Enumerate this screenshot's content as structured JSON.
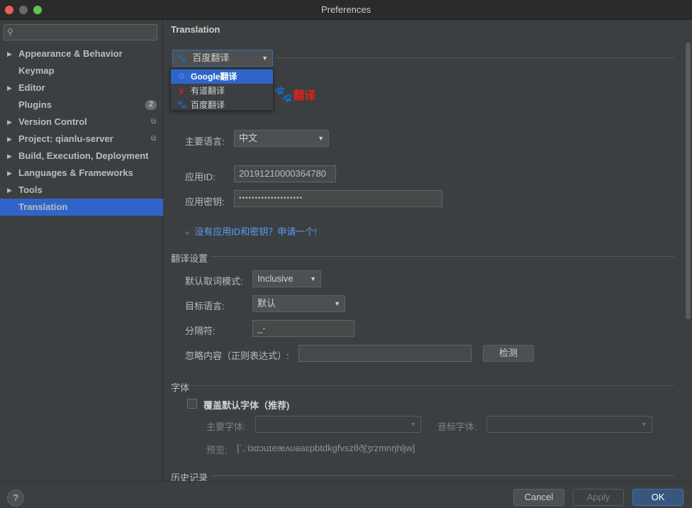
{
  "window": {
    "title": "Preferences"
  },
  "sidebar": {
    "search_placeholder": "",
    "items": [
      {
        "label": "Appearance & Behavior",
        "expandable": true
      },
      {
        "label": "Keymap",
        "expandable": false
      },
      {
        "label": "Editor",
        "expandable": true
      },
      {
        "label": "Plugins",
        "expandable": false,
        "badge": "2"
      },
      {
        "label": "Version Control",
        "expandable": true
      },
      {
        "label": "Project: qianlu-server",
        "expandable": true
      },
      {
        "label": "Build, Execution, Deployment",
        "expandable": true
      },
      {
        "label": "Languages & Frameworks",
        "expandable": true
      },
      {
        "label": "Tools",
        "expandable": true
      },
      {
        "label": "Translation",
        "expandable": false,
        "selected": true
      }
    ]
  },
  "main": {
    "title": "Translation",
    "engine": {
      "selected": "百度翻译",
      "options": [
        "Google翻译",
        "有道翻译",
        "百度翻译"
      ],
      "highlighted": "Google翻译",
      "logo_text": "翻译"
    },
    "primary_language_label": "主要语言:",
    "primary_language_value": "中文",
    "app_id_label": "应用ID:",
    "app_id_value": "20191210000364780",
    "app_key_label": "应用密钥:",
    "app_key_value": "••••••••••••••••••••",
    "apply_link": "没有应用ID和密钥？申请一个!",
    "translate_settings": {
      "title": "翻译设置",
      "word_mode_label": "默认取词模式:",
      "word_mode_value": "Inclusive",
      "target_lang_label": "目标语言:",
      "target_lang_value": "默认",
      "separator_label": "分隔符:",
      "separator_value": "_-",
      "ignore_label": "忽略内容（正则表达式）:",
      "ignore_value": "",
      "detect_button": "检测"
    },
    "font": {
      "title": "字体",
      "override_label": "覆盖默认字体（推荐)",
      "override_checked": false,
      "primary_font_label": "主要字体:",
      "phonetic_font_label": "音标字体:",
      "preview_label": "预览:",
      "preview_value": "[ˈ,ːiɜɑɔuɪeæʌʊəaɛpbtdkgfvszθðʃʒrzmnŋhljw]"
    },
    "history_title": "历史记录"
  },
  "footer": {
    "help": "?",
    "cancel": "Cancel",
    "apply": "Apply",
    "ok": "OK"
  }
}
